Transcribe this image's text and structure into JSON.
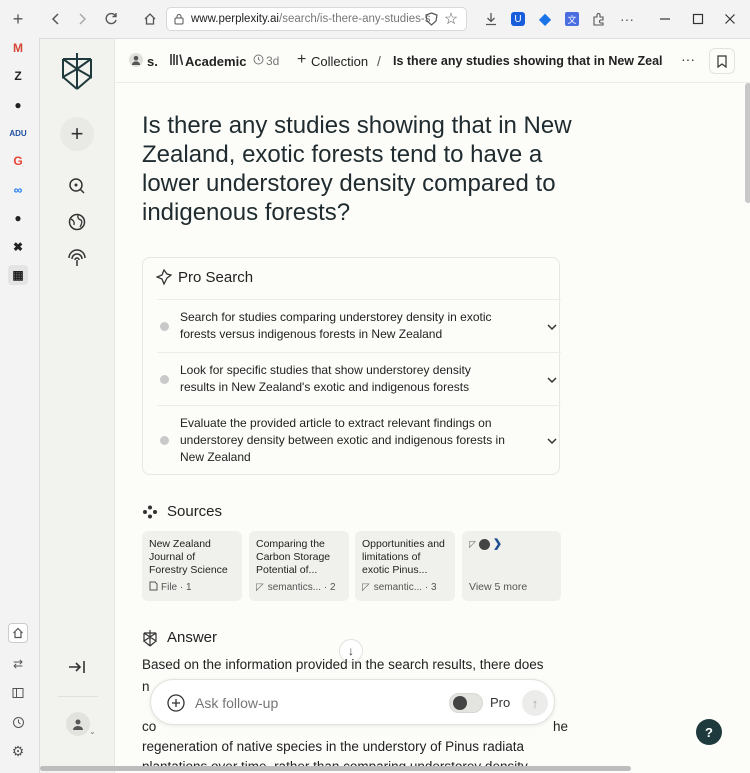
{
  "browser": {
    "url_host": "www.perplexity.ai",
    "url_path": "/search/is-there-any-studies-s"
  },
  "sidebar_apps": [
    {
      "icon": "gmail-icon",
      "glyph": "M",
      "color": "#d44638"
    },
    {
      "icon": "zotero-icon",
      "glyph": "Z",
      "color": "#222"
    },
    {
      "icon": "github-icon",
      "glyph": "●",
      "color": "#222"
    },
    {
      "icon": "adu-icon",
      "glyph": "ADU",
      "color": "#1f4fa0"
    },
    {
      "icon": "google-icon",
      "glyph": "G",
      "color": "#ea4335"
    },
    {
      "icon": "meta-icon",
      "glyph": "∞",
      "color": "#1877f2"
    },
    {
      "icon": "github-icon-2",
      "glyph": "●",
      "color": "#222"
    },
    {
      "icon": "x-icon",
      "glyph": "✖",
      "color": "#222"
    },
    {
      "icon": "perplexity-icon",
      "glyph": "▦",
      "color": "#222"
    }
  ],
  "breadcrumb": {
    "user": "s.",
    "focus": "Academic",
    "age": "3d",
    "collection": "Collection",
    "separator": "/",
    "title": "Is there any studies showing that in New Zeala..."
  },
  "question": "Is there any studies showing that in New Zealand, exotic forests tend to have a lower understorey density compared to indigenous forests?",
  "pro_search": {
    "heading": "Pro Search",
    "steps": [
      {
        "lines": [
          "Search for studies comparing understorey density in exotic",
          "forests versus indigenous forests in New Zealand"
        ]
      },
      {
        "lines": [
          "Look for specific studies that show understorey density",
          "results in New Zealand's exotic and indigenous forests"
        ]
      },
      {
        "lines": [
          "Evaluate the provided article to extract relevant findings on",
          "understorey density between exotic and indigenous forests in",
          "New Zealand"
        ]
      }
    ]
  },
  "sources": {
    "heading": "Sources",
    "items": [
      {
        "lines": [
          "New Zealand",
          "Journal of",
          "Forestry Science"
        ],
        "meta": "File · 1"
      },
      {
        "lines": [
          "Comparing the",
          "Carbon Storage",
          "Potential of..."
        ],
        "meta": "semantics... · 2"
      },
      {
        "lines": [
          "Opportunities and",
          "limitations of",
          "exotic Pinus..."
        ],
        "meta": "semantic... · 3"
      }
    ],
    "more": "View 5 more"
  },
  "answer": {
    "heading": "Answer",
    "line1": "Based on the information provided in the search results, there does",
    "line2": "n",
    "line3": "co",
    "line3_end": "he",
    "line4": "regeneration of native species in the understory of Pinus radiata",
    "line5": "plantations over time, rather than comparing understorey density"
  },
  "followup": {
    "placeholder": "Ask follow-up",
    "pro_label": "Pro",
    "pro_enabled": false
  },
  "help_label": "?"
}
